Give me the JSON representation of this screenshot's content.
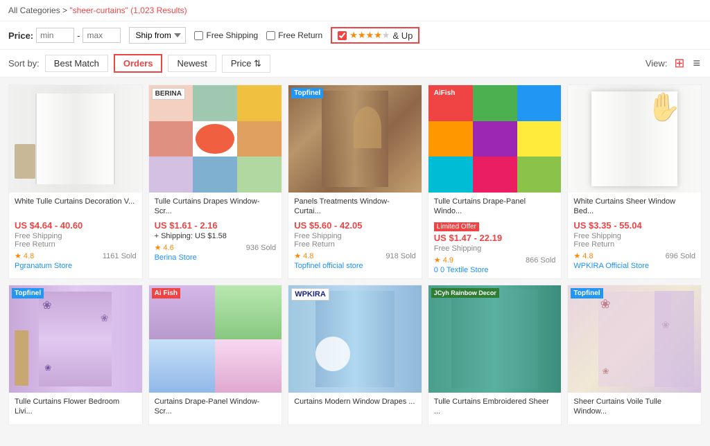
{
  "breadcrumb": {
    "all_categories": "All Categories",
    "search_term": "\"sheer-curtains\"",
    "results_count": "(1,023 Results)"
  },
  "filters": {
    "price_label": "Price:",
    "min_placeholder": "min",
    "max_placeholder": "max",
    "separator": "-",
    "ship_from_label": "Ship from",
    "free_shipping_label": "Free Shipping",
    "free_return_label": "Free Return",
    "rating_label": "& Up"
  },
  "sort": {
    "label": "Sort by:",
    "options": [
      "Best Match",
      "Orders",
      "Newest",
      "Price"
    ],
    "active": "Orders",
    "view_label": "View:"
  },
  "products": [
    {
      "id": 1,
      "title": "White Tulle Curtains Decoration V...",
      "price": "US $4.64 - 40.60",
      "shipping": "Free Shipping",
      "free_return": "Free Return",
      "rating": "4.8",
      "sold": "1161 Sold",
      "store": "Pgranatum Store",
      "style": "single-white",
      "brand": null,
      "limited": false
    },
    {
      "id": 2,
      "title": "Tulle Curtains Drapes Window-Scr...",
      "price": "US $1.61 - 2.16",
      "shipping": "+ Shipping: US $1.58",
      "free_return": null,
      "rating": "4.6",
      "sold": "936 Sold",
      "store": "Berina Store",
      "style": "grid-color",
      "brand": "BERINA",
      "brand_class": "berina",
      "limited": false
    },
    {
      "id": 3,
      "title": "Panels Treatments Window-Curtai...",
      "price": "US $5.60 - 42.05",
      "shipping": "Free Shipping",
      "free_return": "Free Return",
      "rating": "4.8",
      "sold": "918 Sold",
      "store": "Topfinel official store",
      "style": "single-brown",
      "brand": "Topfinel",
      "brand_class": "topfinel",
      "limited": false
    },
    {
      "id": 4,
      "title": "Tulle Curtains Drape-Panel Windo...",
      "price": "US $1.47 - 22.19",
      "shipping": "Free Shipping",
      "free_return": null,
      "rating": "4.9",
      "sold": "866 Sold",
      "store": "0 0 Textile Store",
      "style": "grid-color2",
      "brand": "AiFish",
      "brand_class": "aifish",
      "limited": true
    },
    {
      "id": 5,
      "title": "White Curtains Sheer Window Bed...",
      "price": "US $3.35 - 55.04",
      "shipping": "Free Shipping",
      "free_return": "Free Return",
      "rating": "4.8",
      "sold": "696 Sold",
      "store": "WPKIRA Official Store",
      "style": "single-white2",
      "brand": null,
      "limited": false
    },
    {
      "id": 6,
      "title": "Tulle Curtains Flower Bedroom Livi...",
      "price": "",
      "shipping": "",
      "free_return": null,
      "rating": "",
      "sold": "",
      "store": "",
      "style": "single-purple",
      "brand": "Topfinel",
      "brand_class": "topfinel2",
      "limited": false
    },
    {
      "id": 7,
      "title": "Curtains Drape-Panel Window-Scr...",
      "price": "",
      "shipping": "",
      "free_return": null,
      "rating": "",
      "sold": "",
      "store": "",
      "style": "grid-purple",
      "brand": "Ai Fish",
      "brand_class": "aifish",
      "limited": false
    },
    {
      "id": 8,
      "title": "Curtains Modern Window Drapes ...",
      "price": "",
      "shipping": "",
      "free_return": null,
      "rating": "",
      "sold": "",
      "store": "",
      "style": "single-blue",
      "brand": "WPKIRA",
      "brand_class": "wpkira",
      "limited": false
    },
    {
      "id": 9,
      "title": "Tulle Curtains Embroidered Sheer ...",
      "price": "",
      "shipping": "",
      "free_return": null,
      "rating": "",
      "sold": "",
      "store": "",
      "style": "single-teal",
      "brand": "JCyh Rainbow Decor",
      "brand_class": "jcyh",
      "limited": false
    },
    {
      "id": 10,
      "title": "Sheer Curtains Voile Tulle Window...",
      "price": "",
      "shipping": "",
      "free_return": null,
      "rating": "",
      "sold": "",
      "store": "",
      "style": "single-floral",
      "brand": "Topfinel",
      "brand_class": "topfinel",
      "limited": false
    }
  ]
}
